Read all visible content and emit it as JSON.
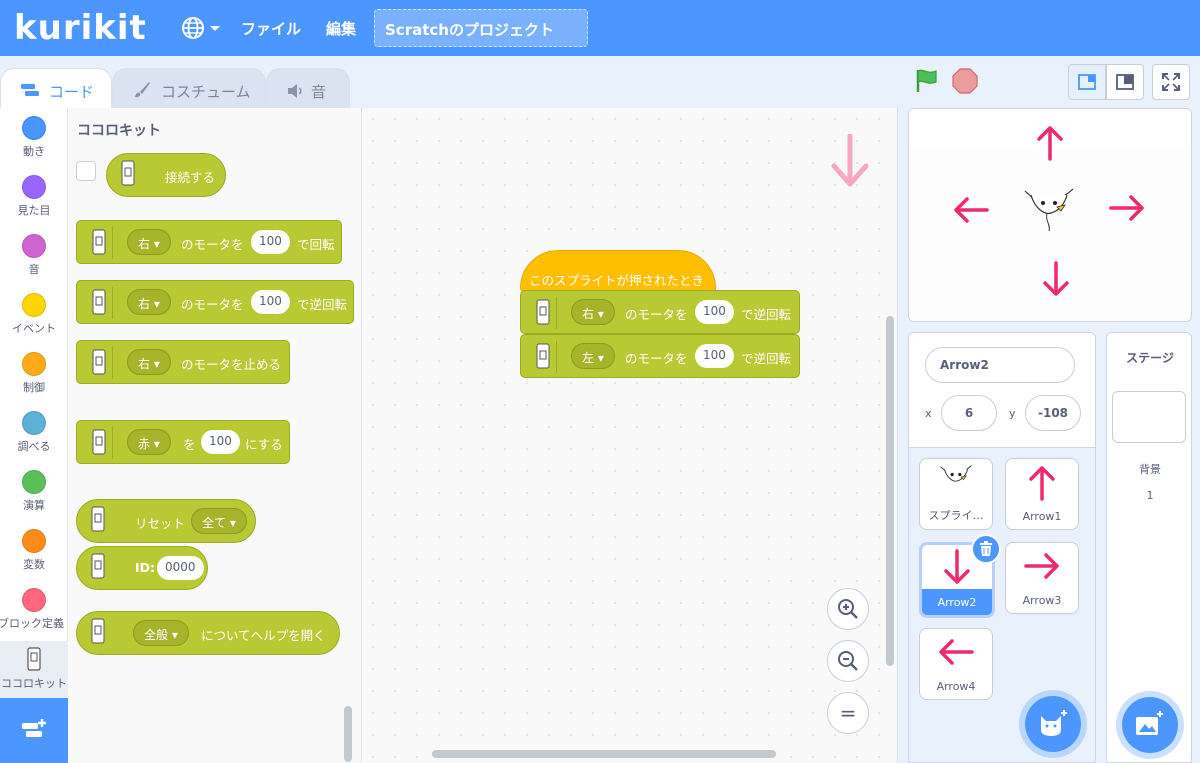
{
  "menubar": {
    "logo": "kurikit",
    "file_label": "ファイル",
    "edit_label": "編集",
    "project_title": "Scratchのプロジェクト"
  },
  "tabs": [
    {
      "label": "コード",
      "active": true
    },
    {
      "label": "コスチューム",
      "active": false
    },
    {
      "label": "音",
      "active": false
    }
  ],
  "categories": [
    {
      "label": "動き",
      "color": "#4c97ff"
    },
    {
      "label": "見た目",
      "color": "#9966ff"
    },
    {
      "label": "音",
      "color": "#cf63cf"
    },
    {
      "label": "イベント",
      "color": "#ffd500"
    },
    {
      "label": "制御",
      "color": "#ffab19"
    },
    {
      "label": "調べる",
      "color": "#5cb1d6"
    },
    {
      "label": "演算",
      "color": "#59c059"
    },
    {
      "label": "変数",
      "color": "#ff8c1a"
    },
    {
      "label": "ブロック定義",
      "color": "#ff6680"
    },
    {
      "label": "ココロキット",
      "color": "#b9c934"
    }
  ],
  "palette": {
    "heading": "ココロキット",
    "connect": "接続する",
    "motor_forward": {
      "side": "右",
      "mid": "のモータを",
      "value": "100",
      "end": "で回転"
    },
    "motor_reverse": {
      "side": "右",
      "mid": "のモータを",
      "value": "100",
      "end": "で逆回転"
    },
    "motor_stop": {
      "side": "右",
      "end": "のモータを止める"
    },
    "led": {
      "color": "赤",
      "mid": "を",
      "value": "100",
      "end": "にする"
    },
    "reset": {
      "label": "リセット",
      "option": "全て"
    },
    "id": {
      "label": "ID:",
      "value": "0000"
    },
    "help": {
      "option": "全般",
      "end": "についてヘルプを開く"
    }
  },
  "script": {
    "hat": "このスプライトが押されたとき",
    "block1": {
      "side": "右",
      "mid": "のモータを",
      "value": "100",
      "end": "で逆回転"
    },
    "block2": {
      "side": "左",
      "mid": "のモータを",
      "value": "100",
      "end": "で逆回転"
    }
  },
  "zoom": {
    "in": "+",
    "out": "−",
    "reset": "="
  },
  "sprite_info": {
    "name": "Arrow2",
    "x_label": "x",
    "x_value": "6",
    "y_label": "y",
    "y_value": "-108"
  },
  "sprites": [
    {
      "name": "スプライ…",
      "icon": "bird-sprite"
    },
    {
      "name": "Arrow1",
      "icon": "arrow-up"
    },
    {
      "name": "Arrow2",
      "icon": "arrow-down",
      "selected": true
    },
    {
      "name": "Arrow3",
      "icon": "arrow-right"
    },
    {
      "name": "Arrow4",
      "icon": "arrow-left"
    }
  ],
  "stage_panel": {
    "title": "ステージ",
    "backdrop_label": "背景",
    "backdrop_count": "1"
  },
  "colors": {
    "accent": "#4c97ff",
    "block": "#b9c934",
    "event": "#ffbf00",
    "arrow": "#ee2a6f"
  }
}
